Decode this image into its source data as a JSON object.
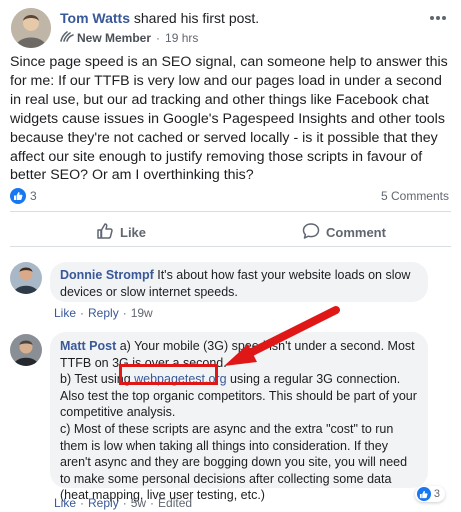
{
  "post": {
    "author_name": "Tom Watts",
    "action_text": "shared his first post.",
    "badge_label": "New Member",
    "time": "19 hrs",
    "body": "Since page speed is an SEO signal, can someone help to answer this for me: If our TTFB is very low and our pages load in under a second in real use, but our ad tracking and other things like Facebook chat widgets cause issues in Google's Pagespeed Insights and other tools because they're not cached or served locally - is it possible that they affect our site enough to justify removing those scripts in favour of better SEO? Or am I overthinking this?",
    "like_count": "3",
    "comments_count": "5 Comments"
  },
  "actions": {
    "like_label": "Like",
    "comment_label": "Comment"
  },
  "comments": [
    {
      "author": "Donnie Strompf",
      "text": "It's about how fast your website loads on slow devices or slow internet speeds.",
      "like": "Like",
      "reply": "Reply",
      "time": "19w"
    },
    {
      "author": "Matt Post",
      "line_a": "a) Your mobile (3G) speed isn't under a second. Most TTFB on 3G is over a second.",
      "line_b_pre": "b) Test using ",
      "line_b_link": "webpagetest.org",
      "line_b_post": " using a regular 3G connection. Also test the top organic competitors. This should be part of your competitive analysis.",
      "line_c": "c) Most of these scripts are async and the extra \"cost\" to run them is low when taking all things into consideration. If they aren't async and they are bogging down you site, you will need to make some personal decisions after collecting some data (heat mapping, live user testing, etc.)",
      "like": "Like",
      "reply": "Reply",
      "time": "5w",
      "edited": "Edited",
      "reaction_count": "3"
    }
  ],
  "colors": {
    "link": "#385898",
    "accent": "#1877f2",
    "annotation": "#e01717"
  }
}
